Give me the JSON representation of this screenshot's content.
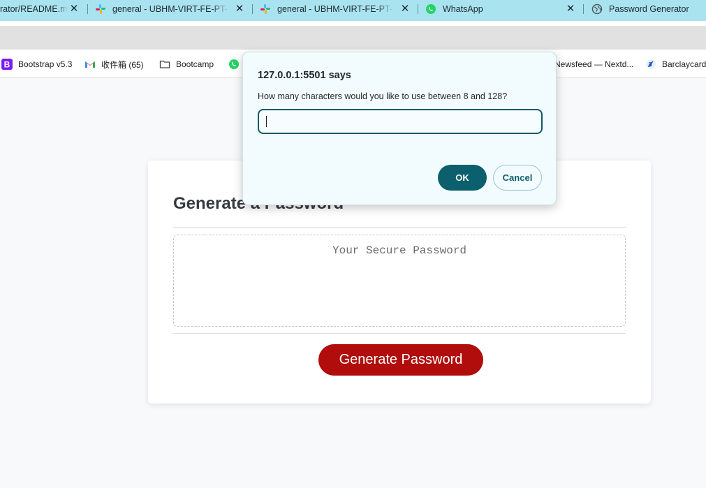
{
  "browser": {
    "tabs": [
      {
        "label": "rator/README.m",
        "icon": "github-icon"
      },
      {
        "label": "general - UBHM-VIRT-FE-PT-11",
        "icon": "slack-icon"
      },
      {
        "label": "general - UBHM-VIRT-FE-PT-11",
        "icon": "slack-icon"
      },
      {
        "label": "WhatsApp",
        "icon": "whatsapp-icon"
      },
      {
        "label": "Password Generator",
        "icon": "globe-icon"
      }
    ],
    "close_glyph": "✕",
    "bookmarks": [
      {
        "label": "Bootstrap v5.3",
        "icon": "bootstrap-icon"
      },
      {
        "label": "收件箱 (65)",
        "icon": "gmail-icon"
      },
      {
        "label": "Bootcamp",
        "icon": "folder-icon"
      },
      {
        "label": "",
        "icon": "whatsapp-icon"
      },
      {
        "label": "Newsfeed — Nextd...",
        "icon": ""
      },
      {
        "label": "Barclaycard",
        "icon": "barclaycard-icon"
      }
    ]
  },
  "dialog": {
    "title": "127.0.0.1:5501 says",
    "message": "How many characters would you like to use between 8 and 128?",
    "input_value": "",
    "ok_label": "OK",
    "cancel_label": "Cancel"
  },
  "page": {
    "heading": "Generate a Password",
    "password_placeholder": "Your Secure Password",
    "generate_label": "Generate Password"
  },
  "colors": {
    "tabstrip": "#a9e3ef",
    "dialog_accent": "#0c5f6c",
    "generate_button": "#b10d0d"
  }
}
